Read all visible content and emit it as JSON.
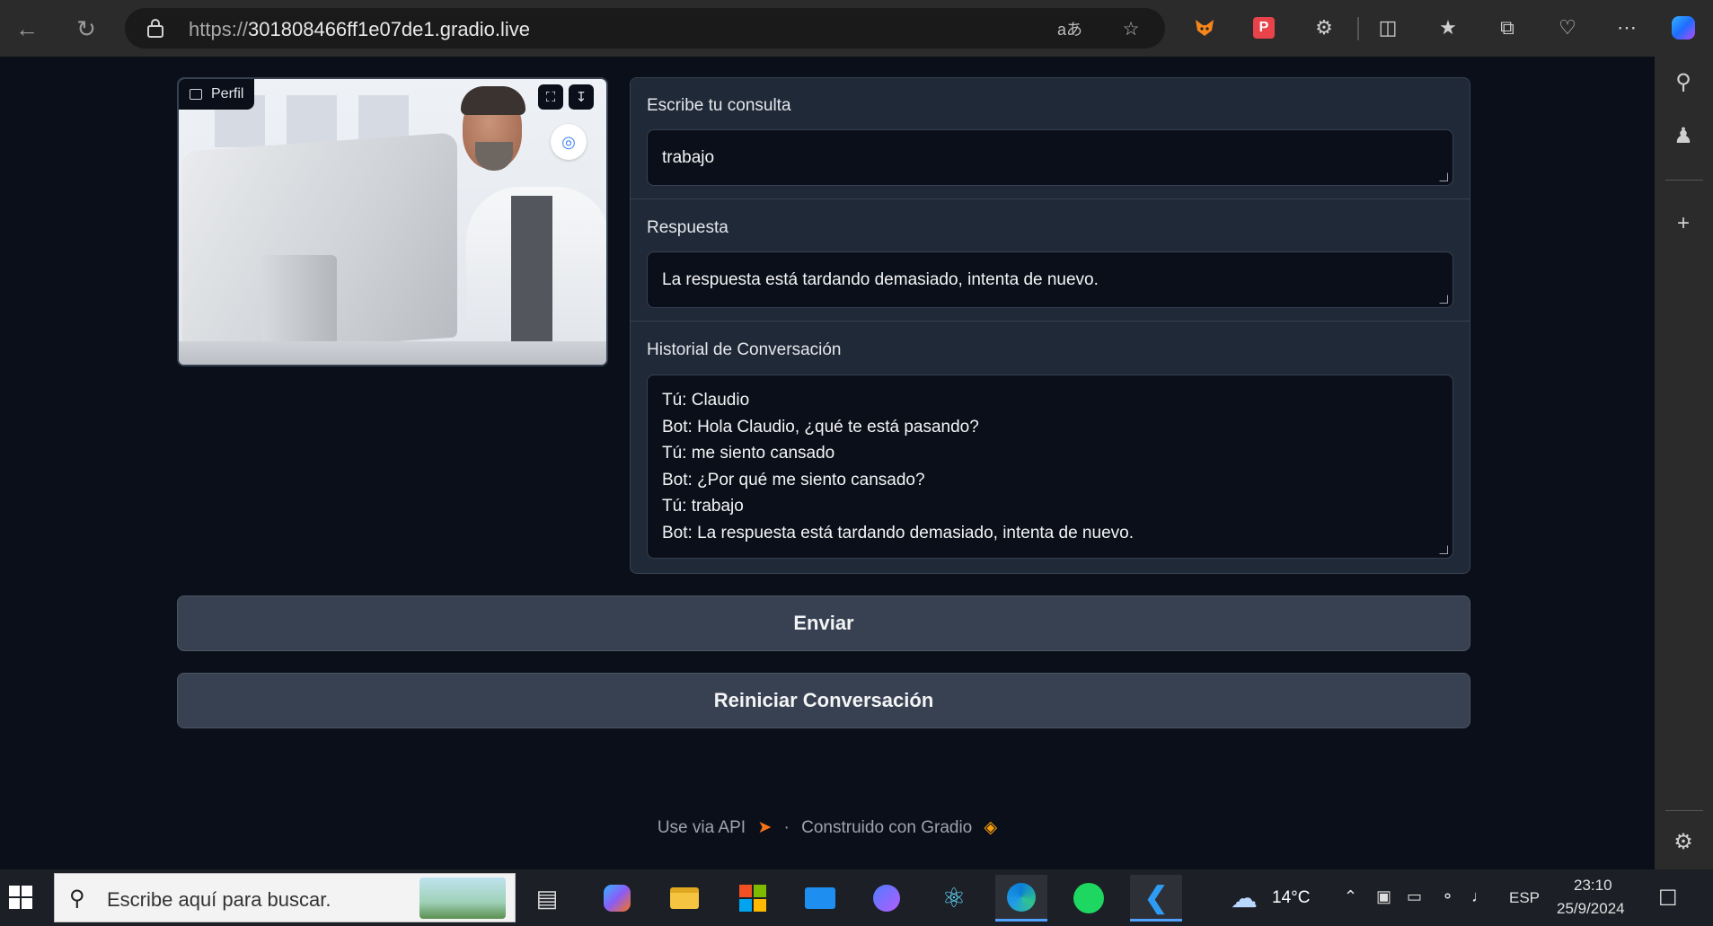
{
  "browser": {
    "url_prefix": "https://",
    "url_host": "301808466ff1e07de1.gradio.live",
    "read_aloud_icon": "aあ"
  },
  "image_panel": {
    "label": "Perfil"
  },
  "form": {
    "query_label": "Escribe tu consulta",
    "query_value": "trabajo",
    "response_label": "Respuesta",
    "response_value": "La respuesta está tardando demasiado, intenta de nuevo.",
    "history_label": "Historial de Conversación",
    "history_lines": [
      "Tú: Claudio",
      "Bot: Hola Claudio, ¿qué te está pasando?",
      "Tú: me siento cansado",
      "Bot: ¿Por qué me siento cansado?",
      "Tú: trabajo",
      "Bot: La respuesta está tardando demasiado, intenta de nuevo."
    ]
  },
  "buttons": {
    "send": "Enviar",
    "reset": "Reiniciar Conversación"
  },
  "footer": {
    "api": "Use via API",
    "separator": "·",
    "built_with": "Construido con Gradio"
  },
  "taskbar": {
    "search_placeholder": "Escribe aquí para buscar.",
    "weather": "14°C",
    "language": "ESP",
    "time": "23:10",
    "date": "25/9/2024"
  },
  "colors": {
    "page_bg": "#0b0f19",
    "panel_bg": "#1f2937",
    "button_bg": "#374151",
    "chrome_bg": "#2b2b2b"
  }
}
